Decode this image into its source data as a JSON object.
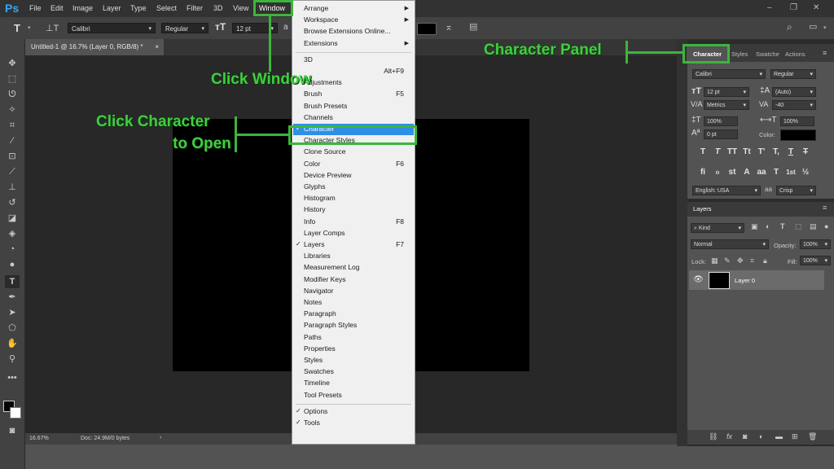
{
  "app": {
    "logo": "Ps"
  },
  "menubar": {
    "items": [
      "File",
      "Edit",
      "Image",
      "Layer",
      "Type",
      "Select",
      "Filter",
      "3D",
      "View",
      "Window"
    ],
    "window_controls": [
      "–",
      "❐",
      "✕"
    ]
  },
  "options": {
    "font_family": "Calibri",
    "font_style": "Regular",
    "font_size": "12 pt",
    "aa_prefix": "a"
  },
  "document": {
    "tab_title": "Untitled-1 @ 16.7% (Layer 0, RGB/8) *",
    "zoom": "16.67%",
    "doc_info": "Doc: 24.9M/0 bytes"
  },
  "window_menu": {
    "items": [
      {
        "label": "Arrange",
        "shortcut": "",
        "submenu": true,
        "checked": false
      },
      {
        "label": "Workspace",
        "shortcut": "",
        "submenu": true,
        "checked": false
      },
      {
        "label": "Browse Extensions Online...",
        "shortcut": "",
        "submenu": false,
        "checked": false
      },
      {
        "label": "Extensions",
        "shortcut": "",
        "submenu": true,
        "checked": false
      },
      {
        "label": "3D",
        "shortcut": "",
        "submenu": false,
        "checked": false
      },
      {
        "label": "",
        "shortcut": "Alt+F9",
        "submenu": false,
        "checked": false
      },
      {
        "label": "Adjustments",
        "shortcut": "",
        "submenu": false,
        "checked": false
      },
      {
        "label": "Brush",
        "shortcut": "F5",
        "submenu": false,
        "checked": false
      },
      {
        "label": "Brush Presets",
        "shortcut": "",
        "submenu": false,
        "checked": false
      },
      {
        "label": "Channels",
        "shortcut": "",
        "submenu": false,
        "checked": false
      },
      {
        "label": "Character",
        "shortcut": "",
        "submenu": false,
        "checked": true
      },
      {
        "label": "Character Styles",
        "shortcut": "",
        "submenu": false,
        "checked": false
      },
      {
        "label": "Clone Source",
        "shortcut": "",
        "submenu": false,
        "checked": false
      },
      {
        "label": "Color",
        "shortcut": "F6",
        "submenu": false,
        "checked": false
      },
      {
        "label": "Device Preview",
        "shortcut": "",
        "submenu": false,
        "checked": false
      },
      {
        "label": "Glyphs",
        "shortcut": "",
        "submenu": false,
        "checked": false
      },
      {
        "label": "Histogram",
        "shortcut": "",
        "submenu": false,
        "checked": false
      },
      {
        "label": "History",
        "shortcut": "",
        "submenu": false,
        "checked": false
      },
      {
        "label": "Info",
        "shortcut": "F8",
        "submenu": false,
        "checked": false
      },
      {
        "label": "Layer Comps",
        "shortcut": "",
        "submenu": false,
        "checked": false
      },
      {
        "label": "Layers",
        "shortcut": "F7",
        "submenu": false,
        "checked": true
      },
      {
        "label": "Libraries",
        "shortcut": "",
        "submenu": false,
        "checked": false
      },
      {
        "label": "Measurement Log",
        "shortcut": "",
        "submenu": false,
        "checked": false
      },
      {
        "label": "Modifier Keys",
        "shortcut": "",
        "submenu": false,
        "checked": false
      },
      {
        "label": "Navigator",
        "shortcut": "",
        "submenu": false,
        "checked": false
      },
      {
        "label": "Notes",
        "shortcut": "",
        "submenu": false,
        "checked": false
      },
      {
        "label": "Paragraph",
        "shortcut": "",
        "submenu": false,
        "checked": false
      },
      {
        "label": "Paragraph Styles",
        "shortcut": "",
        "submenu": false,
        "checked": false
      },
      {
        "label": "Paths",
        "shortcut": "",
        "submenu": false,
        "checked": false
      },
      {
        "label": "Properties",
        "shortcut": "",
        "submenu": false,
        "checked": false
      },
      {
        "label": "Styles",
        "shortcut": "",
        "submenu": false,
        "checked": false
      },
      {
        "label": "Swatches",
        "shortcut": "",
        "submenu": false,
        "checked": false
      },
      {
        "label": "Timeline",
        "shortcut": "",
        "submenu": false,
        "checked": false
      },
      {
        "label": "Tool Presets",
        "shortcut": "",
        "submenu": false,
        "checked": false
      },
      {
        "label": "Options",
        "shortcut": "",
        "submenu": false,
        "checked": true
      },
      {
        "label": "Tools",
        "shortcut": "",
        "submenu": false,
        "checked": true
      }
    ]
  },
  "character_panel": {
    "tabs": [
      "Character",
      "Styles",
      "Swatche",
      "Actions"
    ],
    "font_family": "Calibri",
    "font_style": "Regular",
    "size": "12 pt",
    "leading": "(Auto)",
    "kerning": "Metrics",
    "tracking": "-40",
    "vscale": "100%",
    "hscale": "100%",
    "baseline": "0 pt",
    "color_label": "Color:",
    "style_buttons": [
      "T",
      "T",
      "TT",
      "Tt",
      "T'",
      "T,",
      "T",
      "T"
    ],
    "ot_buttons": [
      "fi",
      "ℴ",
      "st",
      "A",
      "aa",
      "T",
      "1st",
      "½"
    ],
    "language": "English: USA",
    "antialias": "Crisp"
  },
  "layers_panel": {
    "title": "Layers",
    "filter": "Kind",
    "blend_mode": "Normal",
    "opacity_label": "Opacity:",
    "opacity": "100%",
    "lock_label": "Lock:",
    "fill_label": "Fill:",
    "fill": "100%",
    "layer_name": "Layer 0"
  },
  "annotations": {
    "click_window": "Click Window",
    "click_character_line1": "Click Character",
    "click_character_line2": "to Open",
    "character_panel": "Character Panel"
  },
  "colors": {
    "accent_green": "#3cb53c",
    "menu_highlight": "#2f8fe6"
  }
}
